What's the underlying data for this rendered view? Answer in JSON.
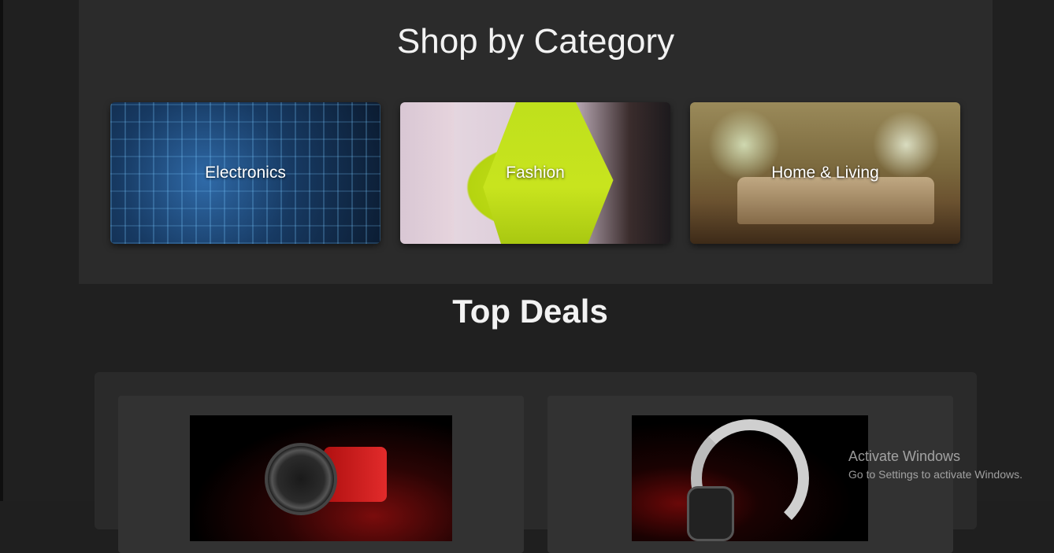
{
  "category_section": {
    "title": "Shop by Category",
    "categories": [
      {
        "label": "Electronics",
        "image": "circuit-board-image"
      },
      {
        "label": "Fashion",
        "image": "yellow-outfit-image"
      },
      {
        "label": "Home & Living",
        "image": "living-room-image"
      }
    ]
  },
  "deals_section": {
    "title": "Top Deals",
    "deals": [
      {
        "image": "smartwatch-image"
      },
      {
        "image": "headphones-image"
      }
    ]
  },
  "watermark": {
    "title": "Activate Windows",
    "subtitle": "Go to Settings to activate Windows."
  }
}
